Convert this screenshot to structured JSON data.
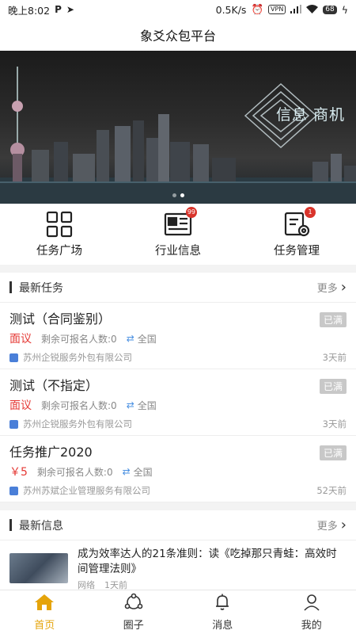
{
  "status_bar": {
    "time": "晚上8:02",
    "network_speed": "0.5K/s",
    "vpn": "VPN",
    "battery": "68"
  },
  "header": {
    "title": "象爻众包平台"
  },
  "banner": {
    "text": "信息 商机",
    "slide_count": 2,
    "active_slide": 2
  },
  "menu": [
    {
      "label": "任务广场",
      "icon": "grid-icon",
      "badge": ""
    },
    {
      "label": "行业信息",
      "icon": "newspaper-icon",
      "badge": "99"
    },
    {
      "label": "任务管理",
      "icon": "task-settings-icon",
      "badge": "1"
    }
  ],
  "tasks_section": {
    "title": "最新任务",
    "more": "更多",
    "items": [
      {
        "title": "测试（合同鉴别）",
        "status": "已满",
        "price": "面议",
        "remaining": "剩余可报名人数:0",
        "location": "全国",
        "company": "苏州企锐服务外包有限公司",
        "time": "3天前"
      },
      {
        "title": "测试（不指定）",
        "status": "已满",
        "price": "面议",
        "remaining": "剩余可报名人数:0",
        "location": "全国",
        "company": "苏州企锐服务外包有限公司",
        "time": "3天前"
      },
      {
        "title": "任务推广2020",
        "status": "已满",
        "price": "￥5",
        "remaining": "剩余可报名人数:0",
        "location": "全国",
        "company": "苏州苏斌企业管理服务有限公司",
        "time": "52天前"
      }
    ]
  },
  "info_section": {
    "title": "最新信息",
    "more": "更多",
    "items": [
      {
        "title": "成为效率达人的21条准则：读《吃掉那只青蛙：高效时间管理法则》",
        "source": "网络",
        "time": "1天前"
      }
    ]
  },
  "tabbar": [
    {
      "label": "首页",
      "icon": "home-icon",
      "active": true
    },
    {
      "label": "圈子",
      "icon": "circle-share-icon",
      "active": false
    },
    {
      "label": "消息",
      "icon": "bell-icon",
      "active": false
    },
    {
      "label": "我的",
      "icon": "user-icon",
      "active": false
    }
  ],
  "colors": {
    "accent": "#e5a40b",
    "price": "#e53935",
    "badge": "#d9342b"
  }
}
